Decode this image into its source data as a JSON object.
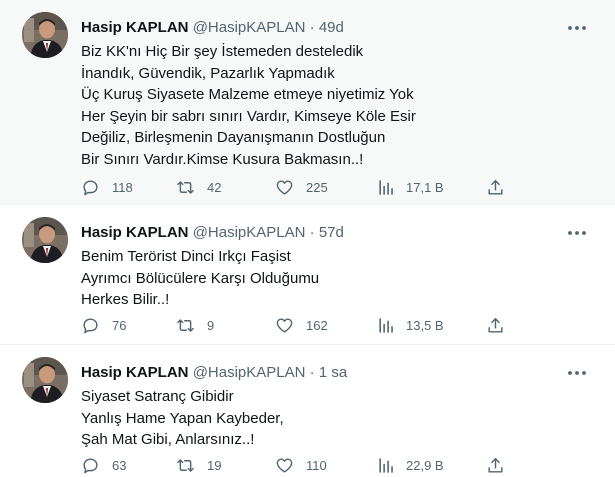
{
  "tweets": [
    {
      "name": "Hasip KAPLAN",
      "handle": "@HasipKAPLAN",
      "separator": "·",
      "time": "49d",
      "lines": [
        "Biz KK'nı Hiç Bir şey İstemeden desteledik",
        "İnandık, Güvendik, Pazarlık Yapmadık",
        "Üç Kuruş Siyasete Malzeme etmeye niyetimiz Yok",
        "Her Şeyin bir sabrı sınırı Vardır, Kimseye Köle Esir",
        "Değiliz, Birleşmenin Dayanışmanın Dostluğun",
        "Bir Sınırı Vardır.Kimse Kusura Bakmasın..!"
      ],
      "replies": "118",
      "retweets": "42",
      "likes": "225",
      "views": "17,1 B"
    },
    {
      "name": "Hasip KAPLAN",
      "handle": "@HasipKAPLAN",
      "separator": "·",
      "time": "57d",
      "lines": [
        "Benim Terörist Dinci Irkçı Faşist",
        "Ayrımcı Bölücülere Karşı Olduğumu",
        "Herkes Bilir..!"
      ],
      "replies": "76",
      "retweets": "9",
      "likes": "162",
      "views": "13,5 B"
    },
    {
      "name": "Hasip KAPLAN",
      "handle": "@HasipKAPLAN",
      "separator": "·",
      "time": "1 sa",
      "lines": [
        "Siyaset Satranç Gibidir",
        "Yanlış Hame Yapan Kaybeder,",
        "Şah Mat Gibi, Anlarsınız..!"
      ],
      "replies": "63",
      "retweets": "19",
      "likes": "110",
      "views": "22,9 B"
    }
  ],
  "icons": {
    "reply": "reply-icon",
    "retweet": "retweet-icon",
    "like": "heart-icon",
    "views": "views-icon",
    "share": "share-icon",
    "more": "more-icon"
  },
  "colors": {
    "text": "#0f1419",
    "secondary": "#536471",
    "highlight_bg": "#f7f9f9",
    "divider": "#eff3f4"
  }
}
